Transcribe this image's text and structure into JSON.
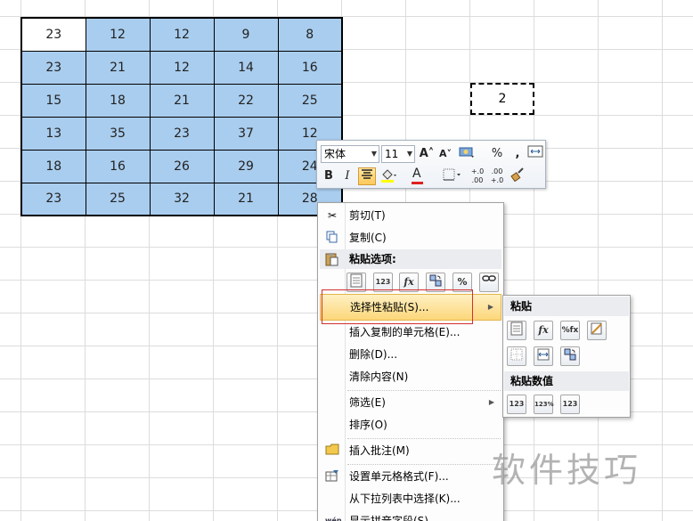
{
  "grid": {
    "rows": [
      [
        "23",
        "12",
        "12",
        "9",
        "8"
      ],
      [
        "23",
        "21",
        "12",
        "14",
        "16"
      ],
      [
        "15",
        "18",
        "21",
        "22",
        "25"
      ],
      [
        "13",
        "35",
        "23",
        "37",
        "12"
      ],
      [
        "18",
        "16",
        "26",
        "29",
        "24"
      ],
      [
        "23",
        "25",
        "32",
        "21",
        "28"
      ]
    ]
  },
  "copy_cell": {
    "value": "2"
  },
  "mini_toolbar": {
    "font_name": "宋体",
    "font_size": "11",
    "grow_font_icon": "A˄",
    "shrink_font_icon": "A˅",
    "percent": "%",
    "comma": ",",
    "bold": "B",
    "italic": "I",
    "font_color_letter": "A",
    "inc_decimal": "+.0 .00",
    "dec_decimal": ".00 +.0"
  },
  "context_menu": {
    "cut": "剪切(T)",
    "copy": "复制(C)",
    "paste_options": "粘贴选项:",
    "paste_special": "选择性粘贴(S)...",
    "insert_copied": "插入复制的单元格(E)...",
    "delete": "删除(D)...",
    "clear": "清除内容(N)",
    "filter": "筛选(E)",
    "sort": "排序(O)",
    "insert_comment": "插入批注(M)",
    "format_cells": "设置单元格格式(F)...",
    "pick_list": "从下拉列表中选择(K)...",
    "phonetic": "显示拼音字段(S)",
    "icons": {
      "p123": "123",
      "pfx": "fx",
      "pct": "%"
    }
  },
  "submenu": {
    "paste_header": "粘贴",
    "values_header": "粘贴数值",
    "icons": {
      "v123": "123",
      "v123pct": "123%",
      "v123fmt": "123",
      "fx": "fx",
      "pctfx": "%fx"
    }
  },
  "watermark": "软件技巧"
}
